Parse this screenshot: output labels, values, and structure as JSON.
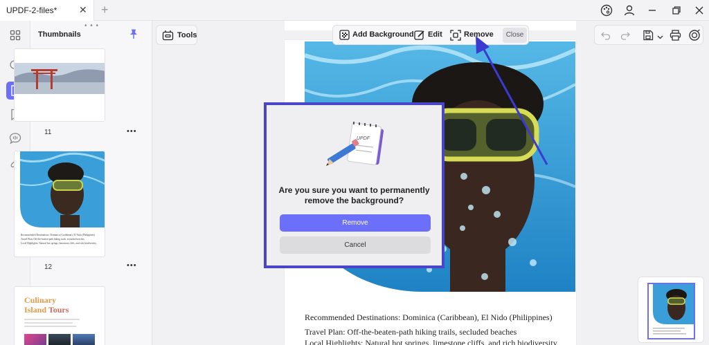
{
  "window": {
    "tab_title": "UPDF-2-files*",
    "tab_close": "✕",
    "tab_add": "+"
  },
  "panel": {
    "title": "Thumbnails",
    "grip": "• • •",
    "thumbs": [
      {
        "label": "11",
        "more": "•••"
      },
      {
        "label": "12",
        "more": "•••"
      },
      {
        "label": "",
        "more": ""
      }
    ],
    "thumb12_text": [
      "Recommended Destinations: Dominica (Caribbean), El Nido (Philippines)",
      "Travel Plan: Off-the-beaten-path hiking trails, secluded beaches",
      "Local Highlights: Natural hot springs, limestone cliffs, and rich biodiversity"
    ],
    "thumb13_title_line1": "Culinary",
    "thumb13_title_line2a": "Island",
    "thumb13_title_line2b": " Tours"
  },
  "toolbar": {
    "tools_label": "Tools",
    "add_background": "Add Background",
    "edit": "Edit",
    "remove": "Remove",
    "close": "Close"
  },
  "page": {
    "lines": [
      "Recommended Destinations: Dominica (Caribbean), El Nido (Philippines)",
      "Travel Plan: Off-the-beaten-path hiking trails, secluded beaches",
      "Local Highlights: Natural hot springs, limestone cliffs, and rich biodiversity"
    ]
  },
  "dialog": {
    "message_line1": "Are you sure you want to permanently",
    "message_line2": "remove the background?",
    "remove_label": "Remove",
    "cancel_label": "Cancel",
    "notepad_text": "UPDF"
  },
  "colors": {
    "accent": "#6c6ffa",
    "dialog_border": "#4b45c9",
    "arrow": "#3b3ad1",
    "water": "#3a9fd8"
  }
}
